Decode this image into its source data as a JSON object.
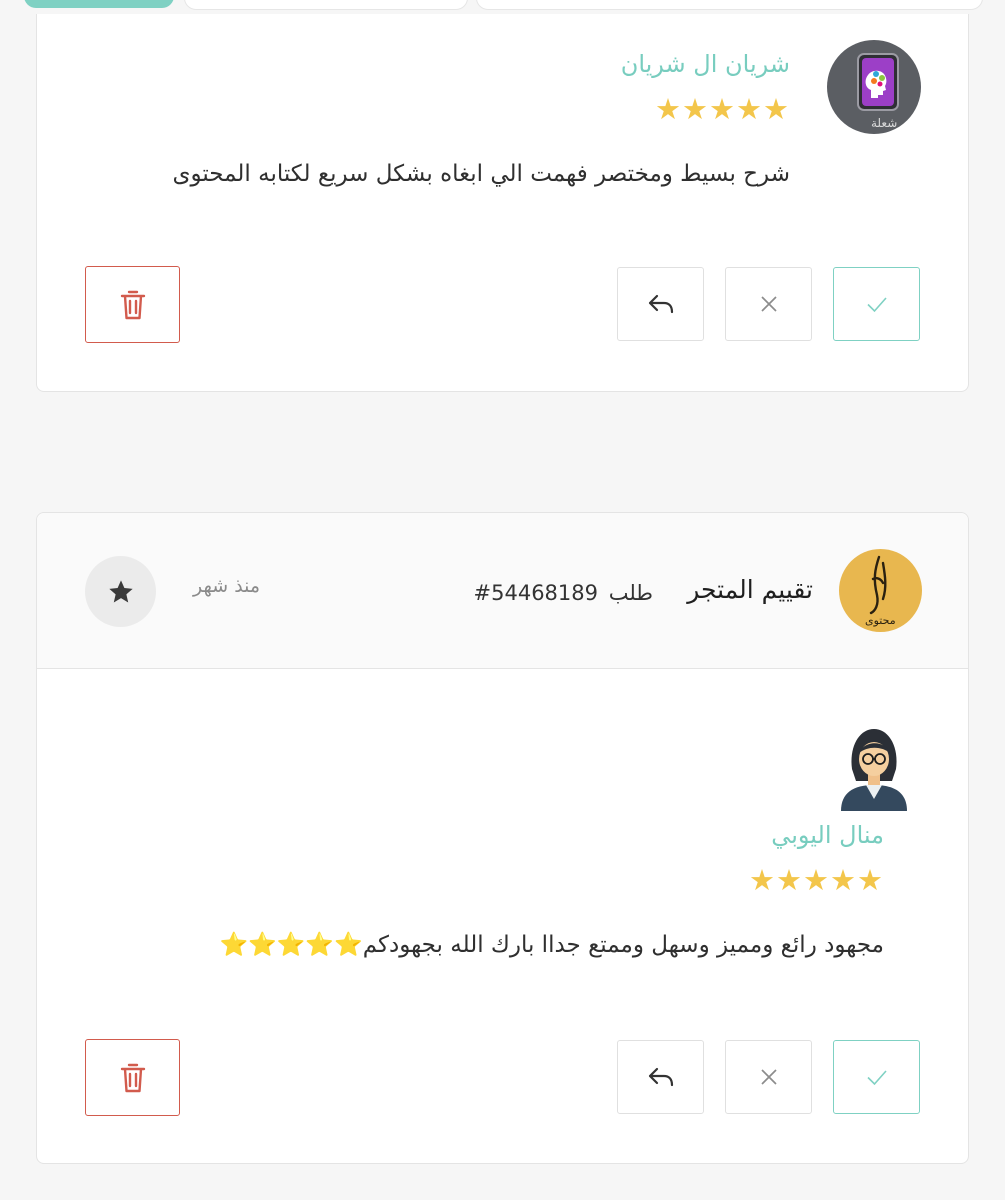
{
  "reviews": [
    {
      "reviewer_name": "شريان ال شريان",
      "rating": 5,
      "rating_stars": "★★★★★",
      "text": "شرح بسيط ومختصر فهمت الي ابغاه بشكل سريع لكتابه المحتوى",
      "avatar_icon": "app-logo-icon",
      "avatar_caption": "شعلة"
    },
    {
      "store_title": "تقييم المتجر",
      "order_label": "طلب",
      "order_number": "#54468189",
      "time_ago": "منذ شهر",
      "store_logo_caption": "محتوى",
      "reviewer_name": "منال اليوبي",
      "rating": 5,
      "rating_stars": "★★★★★",
      "text": "مجهود رائع ومميز وسهل وممتع جداا بارك الله بجهودكم⭐⭐⭐⭐⭐",
      "avatar_icon": "woman-avatar-icon"
    }
  ],
  "actions": {
    "approve_icon": "check-icon",
    "reject_icon": "close-icon",
    "reply_icon": "reply-icon",
    "delete_icon": "trash-icon"
  },
  "colors": {
    "accent": "#7fd1c3",
    "star": "#f3c64b",
    "delete": "#d25b4d",
    "background": "#f6f6f6"
  }
}
